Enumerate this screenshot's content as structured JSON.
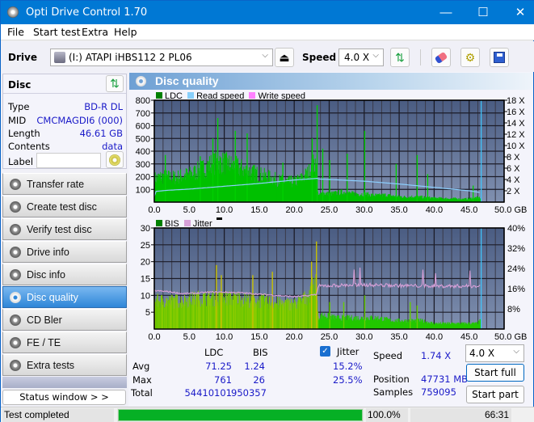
{
  "window": {
    "title": "Opti Drive Control 1.70",
    "minimize": "—",
    "maximize": "☐",
    "close": "✕"
  },
  "menu": [
    "File",
    "Start test",
    "Extra",
    "Help"
  ],
  "toolbar": {
    "drive_label": "Drive",
    "drive_value": "(I:)  ATAPI iHBS112  2 PL06",
    "speed_label": "Speed",
    "speed_value": "4.0 X"
  },
  "disc": {
    "header": "Disc",
    "rows": [
      {
        "label": "Type",
        "value": "BD-R DL"
      },
      {
        "label": "MID",
        "value": "CMCMAGDI6 (000)"
      },
      {
        "label": "Length",
        "value": "46.61 GB"
      },
      {
        "label": "Contents",
        "value": "data"
      }
    ],
    "label_field_label": "Label",
    "label_field_value": ""
  },
  "nav": [
    {
      "label": "Transfer rate",
      "active": false
    },
    {
      "label": "Create test disc",
      "active": false
    },
    {
      "label": "Verify test disc",
      "active": false
    },
    {
      "label": "Drive info",
      "active": false
    },
    {
      "label": "Disc info",
      "active": false
    },
    {
      "label": "Disc quality",
      "active": true
    },
    {
      "label": "CD Bler",
      "active": false
    },
    {
      "label": "FE / TE",
      "active": false
    },
    {
      "label": "Extra tests",
      "active": false
    }
  ],
  "status_window_button": "Status window > >",
  "panel_title": "Disc quality",
  "chart_data": [
    {
      "type": "bar",
      "title": "LDC / Read speed",
      "legend": [
        "LDC",
        "Read speed",
        "Write speed"
      ],
      "legend_colors": [
        "#008000",
        "#87cefa",
        "#ff80ff"
      ],
      "xlabel": "GB",
      "x_ticks": [
        "0.0",
        "5.0",
        "10.0",
        "15.0",
        "20.0",
        "25.0",
        "30.0",
        "35.0",
        "40.0",
        "45.0",
        "50.0 GB"
      ],
      "y_ticks_left": [
        "800",
        "700",
        "600",
        "500",
        "400",
        "300",
        "200",
        "100"
      ],
      "y_ticks_right": [
        "18 X",
        "16 X",
        "14 X",
        "12 X",
        "10 X",
        "8 X",
        "6 X",
        "4 X",
        "2 X"
      ],
      "xlim": [
        0,
        50
      ],
      "ylim": [
        0,
        800
      ],
      "y2lim": [
        0,
        18
      ],
      "disc_end_gb": 46.61,
      "ldc_envelope": {
        "x": [
          0,
          1,
          2,
          3,
          4,
          5,
          6,
          7,
          8,
          9,
          10,
          11,
          12,
          13,
          14,
          15,
          16,
          17,
          18,
          19,
          20,
          21,
          22,
          23,
          23.4,
          24,
          25,
          26,
          27,
          28,
          29,
          30,
          31,
          32,
          33,
          34,
          35,
          36,
          37,
          38,
          39,
          40,
          41,
          42,
          43,
          44,
          45,
          46,
          46.6
        ],
        "y": [
          230,
          250,
          245,
          240,
          260,
          270,
          300,
          330,
          370,
          390,
          385,
          360,
          340,
          310,
          290,
          270,
          250,
          230,
          210,
          200,
          200,
          230,
          290,
          400,
          60,
          90,
          80,
          90,
          100,
          85,
          80,
          80,
          70,
          65,
          70,
          60,
          55,
          50,
          55,
          50,
          45,
          40,
          38,
          35,
          35,
          30,
          35,
          45,
          40
        ]
      },
      "ldc_spikes": [
        {
          "x": 1.5,
          "y": 370
        },
        {
          "x": 6.5,
          "y": 360
        },
        {
          "x": 8.3,
          "y": 500
        },
        {
          "x": 9.0,
          "y": 660
        },
        {
          "x": 11.5,
          "y": 560
        },
        {
          "x": 13.2,
          "y": 540
        },
        {
          "x": 18.3,
          "y": 310
        },
        {
          "x": 22.5,
          "y": 500
        },
        {
          "x": 23.2,
          "y": 761
        },
        {
          "x": 24.0,
          "y": 420
        },
        {
          "x": 25.0,
          "y": 330
        },
        {
          "x": 27.5,
          "y": 380
        },
        {
          "x": 30.0,
          "y": 560
        },
        {
          "x": 34.5,
          "y": 300
        },
        {
          "x": 37.5,
          "y": 370
        },
        {
          "x": 39.0,
          "y": 220
        },
        {
          "x": 45.5,
          "y": 130
        }
      ],
      "read_speed": {
        "x": [
          0,
          0.2,
          2,
          5,
          10,
          15,
          20,
          23.3,
          23.4,
          25,
          30,
          35,
          40,
          45,
          46.6
        ],
        "y": [
          1.0,
          1.9,
          2.1,
          2.3,
          2.8,
          3.3,
          3.9,
          4.2,
          4.1,
          4.0,
          3.7,
          3.2,
          2.6,
          2.0,
          1.7
        ]
      }
    },
    {
      "type": "bar",
      "title": "BIS / Jitter",
      "legend": [
        "BIS",
        "Jitter"
      ],
      "legend_colors": [
        "#008000",
        "#d8a0d8"
      ],
      "xlabel": "GB",
      "x_ticks": [
        "0.0",
        "5.0",
        "10.0",
        "15.0",
        "20.0",
        "25.0",
        "30.0",
        "35.0",
        "40.0",
        "45.0",
        "50.0 GB"
      ],
      "y_ticks_left": [
        "30",
        "25",
        "20",
        "15",
        "10",
        "5"
      ],
      "y_ticks_right": [
        "40%",
        "32%",
        "24%",
        "16%",
        "8%"
      ],
      "xlim": [
        0,
        50
      ],
      "ylim": [
        0,
        30
      ],
      "y2lim": [
        0,
        40
      ],
      "disc_end_gb": 46.61,
      "bis_envelope": {
        "x": [
          0,
          2,
          4,
          6,
          8,
          10,
          12,
          14,
          16,
          18,
          20,
          21,
          22,
          23,
          23.4,
          24,
          26,
          28,
          30,
          32,
          34,
          36,
          38,
          40,
          42,
          44,
          46,
          46.6
        ],
        "y": [
          10,
          10,
          10,
          11,
          11,
          11,
          11,
          10,
          10,
          9,
          9,
          10,
          12,
          17,
          4,
          5,
          4,
          4,
          4,
          4,
          3,
          3,
          3,
          2,
          2,
          2,
          2,
          3
        ]
      },
      "bis_spikes": [
        {
          "x": 8.8,
          "y": 19
        },
        {
          "x": 9.5,
          "y": 16
        },
        {
          "x": 14.0,
          "y": 16
        },
        {
          "x": 16.8,
          "y": 17
        },
        {
          "x": 22.4,
          "y": 20
        },
        {
          "x": 23.1,
          "y": 26
        },
        {
          "x": 25.0,
          "y": 8
        },
        {
          "x": 27.0,
          "y": 8
        },
        {
          "x": 30.0,
          "y": 10
        },
        {
          "x": 36.5,
          "y": 8
        },
        {
          "x": 37.5,
          "y": 7
        }
      ],
      "jitter": {
        "x": [
          0,
          2,
          4,
          6,
          8,
          10,
          12,
          14,
          16,
          18,
          20,
          22,
          23.2,
          23.5,
          25,
          30,
          35,
          40,
          45,
          46.6
        ],
        "y": [
          15.2,
          14.8,
          14.0,
          14.2,
          14.6,
          14.6,
          14.4,
          14.0,
          13.6,
          13.2,
          12.8,
          13.2,
          13.8,
          17.0,
          17.2,
          17.5,
          17.2,
          17.0,
          17.0,
          17.0
        ]
      }
    }
  ],
  "stats": {
    "col_ldc": "LDC",
    "col_bis": "BIS",
    "jitter_label": "Jitter",
    "jitter_checked": true,
    "rows": [
      {
        "label": "Avg",
        "ldc": "71.25",
        "bis": "1.24",
        "jitter": "15.2%"
      },
      {
        "label": "Max",
        "ldc": "761",
        "bis": "26",
        "jitter": "25.5%"
      },
      {
        "label": "Total",
        "ldc": "54410101",
        "bis": "950357"
      }
    ],
    "speed_label": "Speed",
    "speed_value": "1.74 X",
    "position_label": "Position",
    "position_value": "47731 MB",
    "samples_label": "Samples",
    "samples_value": "759095",
    "speed_select": "4.0 X",
    "start_full": "Start full",
    "start_part": "Start part"
  },
  "statusbar": {
    "text": "Test completed",
    "progress_percent": 100,
    "progress_text": "100.0%",
    "time": "66:31"
  }
}
